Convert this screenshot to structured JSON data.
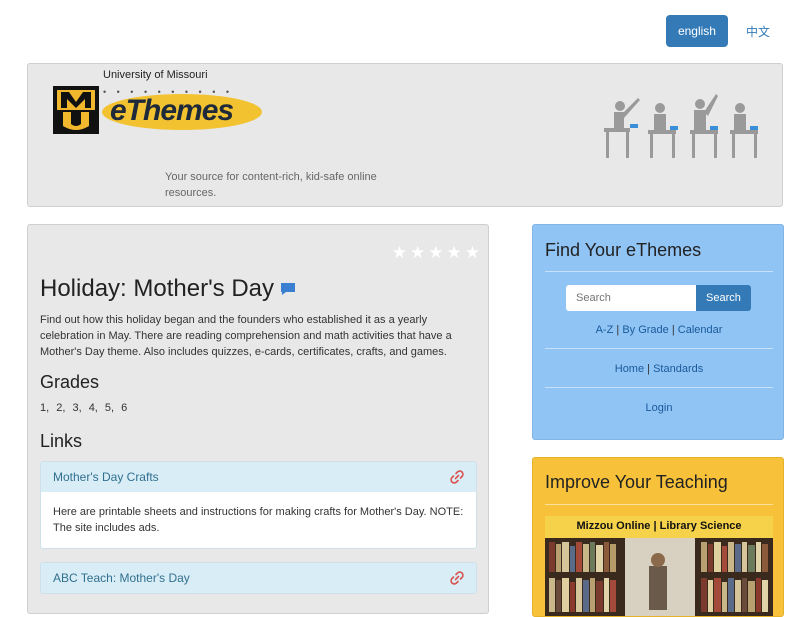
{
  "lang": {
    "english": "english",
    "chinese": "中文"
  },
  "header": {
    "university": "University of Missouri",
    "brand": "eThemes",
    "tagline": "Your source for content-rich, kid-safe online resources."
  },
  "main": {
    "rating_stars": 5,
    "title": "Holiday: Mother's Day",
    "description": "Find out how this holiday began and the founders who established it as a yearly celebration in May. There are reading comprehension and math activities that have a Mother's Day theme. Also includes quizzes, e-cards, certificates, crafts, and games.",
    "grades_heading": "Grades",
    "grades": "1,  2,  3,  4,  5,  6",
    "links_heading": "Links",
    "links": [
      {
        "title": "Mother's Day Crafts",
        "body": "Here are printable sheets and instructions for making crafts for Mother's Day. NOTE: The site includes ads."
      },
      {
        "title": "ABC Teach: Mother's Day",
        "body": ""
      }
    ]
  },
  "find": {
    "title": "Find Your eThemes",
    "search_placeholder": "Search",
    "search_button": "Search",
    "az": "A-Z",
    "by_grade": "By Grade",
    "calendar": "Calendar",
    "home": "Home",
    "standards": "Standards",
    "login": "Login",
    "sep": " | "
  },
  "improve": {
    "title": "Improve Your Teaching",
    "ad_label": "Mizzou Online | Library Science"
  },
  "colors": {
    "primary": "#337ab7",
    "find_bg": "#90c4f5",
    "improve_bg": "#f7c23a",
    "link_head_bg": "#d9edf7"
  }
}
